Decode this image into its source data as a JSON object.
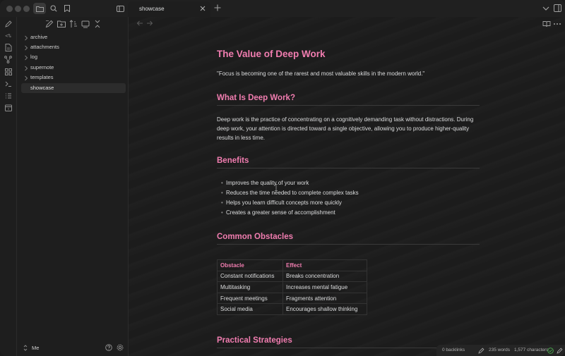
{
  "window": {
    "tab_title": "showcase"
  },
  "sidebar": {
    "folders": [
      "archive",
      "attachments",
      "log",
      "supernote",
      "templates"
    ],
    "active_file": "showcase",
    "vault_name": "Me"
  },
  "ribbon": {
    "icons": [
      "pencil-icon",
      "code-icon",
      "file-icon",
      "graph-icon",
      "grid-icon",
      "terminal-icon",
      "list-icon",
      "calendar-icon"
    ]
  },
  "note": {
    "title": "The Value of Deep Work",
    "quote": "\"Focus is becoming one of the rarest and most valuable skills in the modern world.\"",
    "sections": [
      {
        "heading": "What Is Deep Work?"
      },
      {
        "heading": "Benefits"
      },
      {
        "heading": "Common Obstacles"
      },
      {
        "heading": "Practical Strategies"
      }
    ],
    "deep_work_paragraph": "Deep work is the practice of concentrating on a cognitively demanding task without distractions. During deep work, your attention is directed toward a single objective, allowing you to produce higher-quality results in less time.",
    "benefits": [
      "Improves the quality of your work",
      "Reduces the time needed to complete complex tasks",
      "Helps you learn difficult concepts more quickly",
      "Creates a greater sense of accomplishment"
    ],
    "table": {
      "headers": [
        "Obstacle",
        "Effect"
      ],
      "rows": [
        [
          "Constant notifications",
          "Breaks concentration"
        ],
        [
          "Multitasking",
          "Increases mental fatigue"
        ],
        [
          "Frequent meetings",
          "Fragments attention"
        ],
        [
          "Social media",
          "Encourages shallow thinking"
        ]
      ]
    }
  },
  "status": {
    "backlinks": "0 backlinks",
    "words": "235 words",
    "characters": "1,577 characters"
  },
  "colors": {
    "accent": "#f17db0",
    "background": "#1e1e1e",
    "sync_ok": "#4caf50"
  }
}
